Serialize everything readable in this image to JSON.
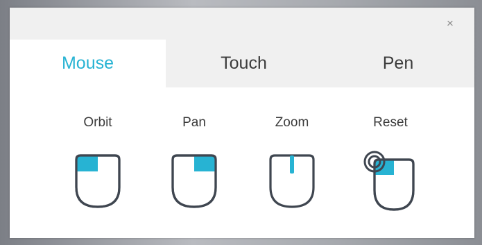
{
  "window": {
    "close_glyph": "×",
    "close_icon": "close-icon"
  },
  "tabs": [
    {
      "label": "Mouse",
      "active": true
    },
    {
      "label": "Touch",
      "active": false
    },
    {
      "label": "Pen",
      "active": false
    }
  ],
  "controls": [
    {
      "label": "Orbit",
      "icon": "mouse-left-button-icon"
    },
    {
      "label": "Pan",
      "icon": "mouse-right-button-icon"
    },
    {
      "label": "Zoom",
      "icon": "mouse-scroll-wheel-icon"
    },
    {
      "label": "Reset",
      "icon": "mouse-double-click-icon"
    }
  ],
  "colors": {
    "accent": "#27b3d3",
    "icon_stroke": "#3f4650",
    "tab_inactive_bg": "#f0f0f0",
    "panel_bg": "#ffffff"
  }
}
